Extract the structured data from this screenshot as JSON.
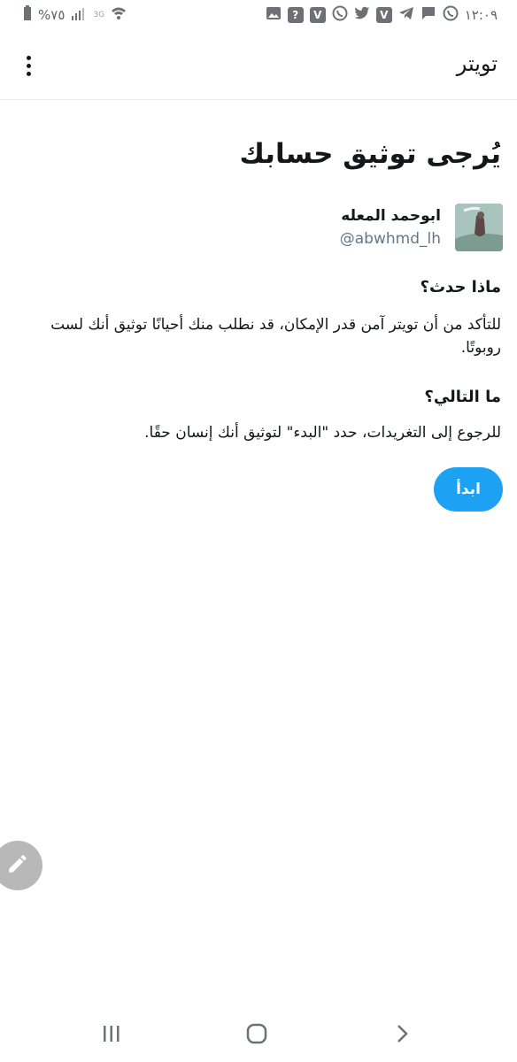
{
  "status_bar": {
    "time": "١٢:٠٩",
    "battery": "%٧٥",
    "network": "3G",
    "notification_icons": [
      "whatsapp-icon",
      "message-icon",
      "telegram-icon",
      "viber-icon",
      "twitter-icon",
      "whatsapp-icon",
      "viber-icon",
      "help-icon",
      "image-icon"
    ]
  },
  "app_bar": {
    "title": "تويتر",
    "menu_icon": "more-vertical-icon"
  },
  "main": {
    "headline": "يُرجى توثيق حسابك",
    "account": {
      "name": "ابوحمد المعله",
      "handle": "@abwhmd_lh"
    },
    "what_happened": {
      "title": "ماذا حدث؟",
      "body": "للتأكد من أن تويتر آمن قدر الإمكان، قد نطلب منك أحيانًا توثيق أنك لست روبوتًا."
    },
    "whats_next": {
      "title": "ما التالي؟",
      "body": "للرجوع إلى التغريدات، حدد \"البدء\" لتوثيق أنك إنسان حقًا."
    },
    "start_button_label": "ابدأ"
  },
  "fab_icon": "compose-pencil-icon",
  "nav_bar": {
    "icons": [
      "recent-apps-icon",
      "home-icon",
      "back-icon"
    ]
  },
  "colors": {
    "accent": "#1da1f2",
    "text": "#14171a",
    "secondary_text": "#657786",
    "fab": "#b8b8b8"
  }
}
